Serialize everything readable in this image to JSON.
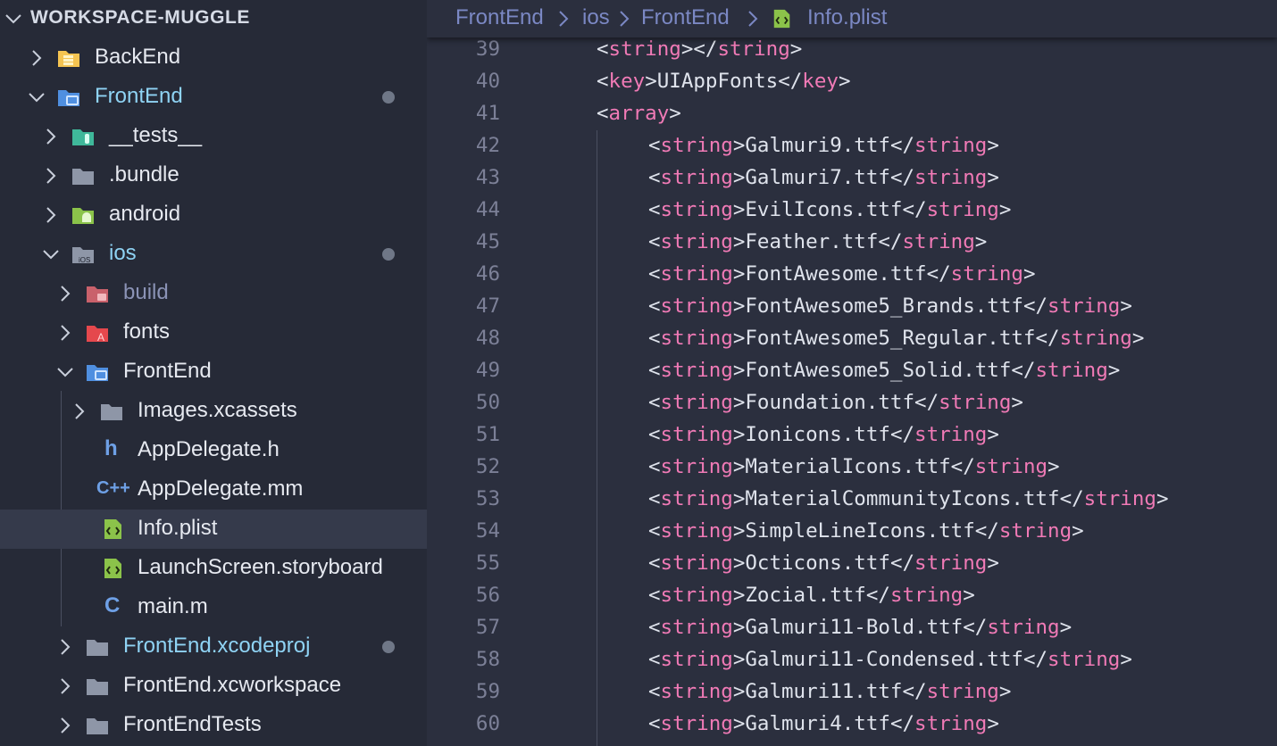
{
  "sidebar": {
    "workspace_title": "WORKSPACE-MUGGLE",
    "items": [
      {
        "label": "BackEnd"
      },
      {
        "label": "FrontEnd"
      },
      {
        "label": "__tests__"
      },
      {
        "label": ".bundle"
      },
      {
        "label": "android"
      },
      {
        "label": "ios"
      },
      {
        "label": "build"
      },
      {
        "label": "fonts"
      },
      {
        "label": "FrontEnd"
      },
      {
        "label": "Images.xcassets"
      },
      {
        "label": "AppDelegate.h"
      },
      {
        "label": "AppDelegate.mm"
      },
      {
        "label": "Info.plist"
      },
      {
        "label": "LaunchScreen.storyboard"
      },
      {
        "label": "main.m"
      },
      {
        "label": "FrontEnd.xcodeproj"
      },
      {
        "label": "FrontEnd.xcworkspace"
      },
      {
        "label": "FrontEndTests"
      }
    ],
    "selected_item": "Info.plist"
  },
  "breadcrumb": [
    "FrontEnd",
    "ios",
    "FrontEnd",
    "Info.plist"
  ],
  "editor": {
    "lines": [
      {
        "num": "39",
        "open": "string",
        "text": "",
        "close": "string"
      },
      {
        "num": "40",
        "open": "key",
        "text": "UIAppFonts",
        "close": "key"
      },
      {
        "num": "41",
        "open": "array",
        "text": "",
        "close": ""
      },
      {
        "num": "42",
        "open": "string",
        "text": "Galmuri9.ttf",
        "close": "string"
      },
      {
        "num": "43",
        "open": "string",
        "text": "Galmuri7.ttf",
        "close": "string"
      },
      {
        "num": "44",
        "open": "string",
        "text": "EvilIcons.ttf",
        "close": "string"
      },
      {
        "num": "45",
        "open": "string",
        "text": "Feather.ttf",
        "close": "string"
      },
      {
        "num": "46",
        "open": "string",
        "text": "FontAwesome.ttf",
        "close": "string"
      },
      {
        "num": "47",
        "open": "string",
        "text": "FontAwesome5_Brands.ttf",
        "close": "string"
      },
      {
        "num": "48",
        "open": "string",
        "text": "FontAwesome5_Regular.ttf",
        "close": "string"
      },
      {
        "num": "49",
        "open": "string",
        "text": "FontAwesome5_Solid.ttf",
        "close": "string"
      },
      {
        "num": "50",
        "open": "string",
        "text": "Foundation.ttf",
        "close": "string"
      },
      {
        "num": "51",
        "open": "string",
        "text": "Ionicons.ttf",
        "close": "string"
      },
      {
        "num": "52",
        "open": "string",
        "text": "MaterialIcons.ttf",
        "close": "string"
      },
      {
        "num": "53",
        "open": "string",
        "text": "MaterialCommunityIcons.ttf",
        "close": "string"
      },
      {
        "num": "54",
        "open": "string",
        "text": "SimpleLineIcons.ttf",
        "close": "string"
      },
      {
        "num": "55",
        "open": "string",
        "text": "Octicons.ttf",
        "close": "string"
      },
      {
        "num": "56",
        "open": "string",
        "text": "Zocial.ttf",
        "close": "string"
      },
      {
        "num": "57",
        "open": "string",
        "text": "Galmuri11-Bold.ttf",
        "close": "string"
      },
      {
        "num": "58",
        "open": "string",
        "text": "Galmuri11-Condensed.ttf",
        "close": "string"
      },
      {
        "num": "59",
        "open": "string",
        "text": "Galmuri11.ttf",
        "close": "string"
      },
      {
        "num": "60",
        "open": "string",
        "text": "Galmuri4.ttf",
        "close": "string"
      }
    ]
  },
  "colors": {
    "sidebar_bg": "#262a37",
    "editor_bg": "#2b2f3e",
    "tag": "#f07ab6",
    "breadcrumb_text": "#7b88c4",
    "modified_dot": "#6f7787"
  }
}
